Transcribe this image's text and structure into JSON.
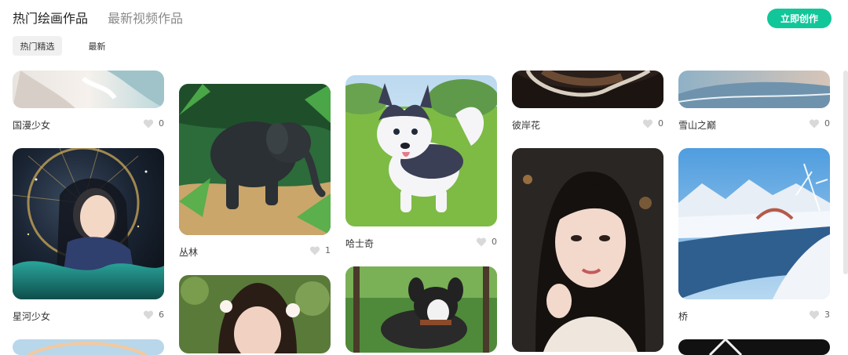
{
  "tabs": {
    "active": "热门绘画作品",
    "other": "最新视频作品"
  },
  "create_button": "立即创作",
  "filters": {
    "active": "热门精选",
    "other": "最新"
  },
  "cards": [
    {
      "title": "国漫少女",
      "likes": "0"
    },
    {
      "title": "星河少女",
      "likes": "6"
    },
    {
      "title": "丛林",
      "likes": "1"
    },
    {
      "title": "哈士奇",
      "likes": "0"
    },
    {
      "title": "彼岸花",
      "likes": "0"
    },
    {
      "title": "雪山之巅",
      "likes": "0"
    },
    {
      "title": "桥",
      "likes": "3"
    }
  ],
  "colors": {
    "accent": "#11c79a"
  }
}
